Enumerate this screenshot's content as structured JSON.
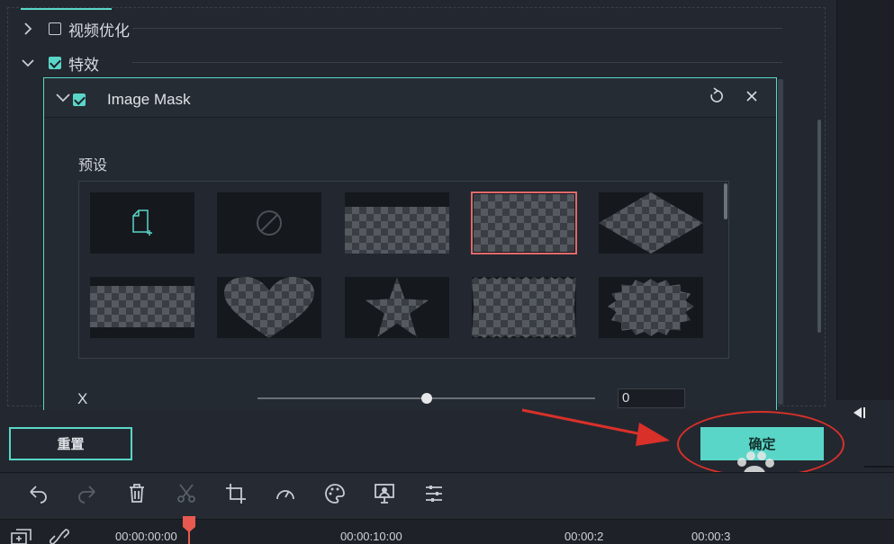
{
  "sections": {
    "video_enhance": {
      "label": "视频优化",
      "checked": false,
      "expanded": false
    },
    "effects": {
      "label": "特效",
      "checked": true,
      "expanded": true
    }
  },
  "mask": {
    "title": "Image Mask",
    "checked": true,
    "preset_label": "预设",
    "presets": [
      "add-custom",
      "none",
      "rectangle-wide",
      "rectangle",
      "diamond",
      "band",
      "heart",
      "star",
      "stamp",
      "burst"
    ],
    "selected_preset": "rectangle",
    "x_label": "X",
    "x_value": "0",
    "x_slider_fraction": 0.5
  },
  "buttons": {
    "reset": "重置",
    "ok": "确定"
  },
  "timeline": {
    "timecodes": [
      "00:00:00:00",
      "00:00:10:00",
      "00:00:2",
      "00:00:3"
    ]
  },
  "colors": {
    "accent": "#5ad6c8",
    "selected_outline": "#e26a6a",
    "annotation_red": "#d9302a"
  }
}
